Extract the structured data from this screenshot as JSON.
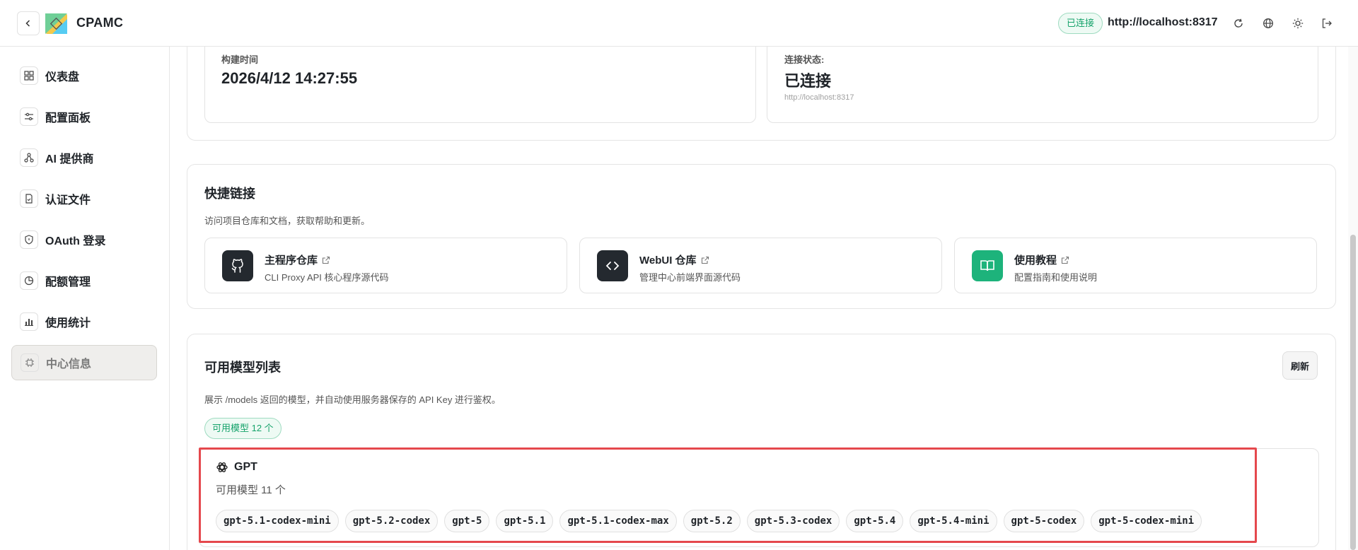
{
  "header": {
    "brand": "CPAMC",
    "connection_badge": "已连接",
    "server_url": "http://localhost:8317"
  },
  "sidebar": {
    "items": [
      {
        "label": "仪表盘",
        "icon": "dashboard-icon"
      },
      {
        "label": "配置面板",
        "icon": "sliders-icon"
      },
      {
        "label": "AI 提供商",
        "icon": "network-icon"
      },
      {
        "label": "认证文件",
        "icon": "file-check-icon"
      },
      {
        "label": "OAuth 登录",
        "icon": "shield-icon"
      },
      {
        "label": "配额管理",
        "icon": "pie-icon"
      },
      {
        "label": "使用统计",
        "icon": "bar-chart-icon"
      },
      {
        "label": "中心信息",
        "icon": "chip-icon"
      }
    ],
    "active_index": 7
  },
  "build_info": {
    "label": "构建时间",
    "value": "2026/4/12 14:27:55"
  },
  "connection_info": {
    "label": "连接状态:",
    "value": "已连接",
    "url": "http://localhost:8317"
  },
  "quick_links": {
    "title": "快捷链接",
    "description": "访问项目仓库和文档，获取帮助和更新。",
    "items": [
      {
        "title": "主程序仓库",
        "desc": "CLI Proxy API 核心程序源代码",
        "icon": "github-icon",
        "color": "#24292f"
      },
      {
        "title": "WebUI 仓库",
        "desc": "管理中心前端界面源代码",
        "icon": "code-icon",
        "color": "#24292f"
      },
      {
        "title": "使用教程",
        "desc": "配置指南和使用说明",
        "icon": "book-icon",
        "color": "#1db37b"
      }
    ]
  },
  "models": {
    "title": "可用模型列表",
    "description": "展示 /models 返回的模型，并自动使用服务器保存的 API Key 进行鉴权。",
    "refresh_label": "刷新",
    "count_label": "可用模型 12 个",
    "group": {
      "name": "GPT",
      "count_text": "可用模型  11  个",
      "models": [
        "gpt-5.1-codex-mini",
        "gpt-5.2-codex",
        "gpt-5",
        "gpt-5.1",
        "gpt-5.1-codex-max",
        "gpt-5.2",
        "gpt-5.3-codex",
        "gpt-5.4",
        "gpt-5.4-mini",
        "gpt-5-codex",
        "gpt-5-codex-mini"
      ]
    }
  },
  "colors": {
    "accent_green": "#16a36b",
    "highlight_red": "#e5484d"
  }
}
